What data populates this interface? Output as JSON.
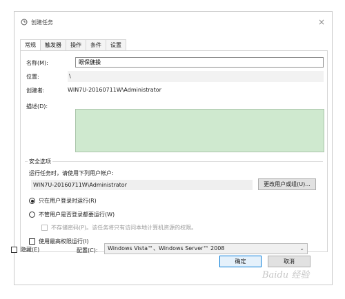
{
  "window": {
    "title": "创建任务",
    "close": "×"
  },
  "tabs": [
    {
      "label": "常规",
      "active": true
    },
    {
      "label": "触发器",
      "active": false
    },
    {
      "label": "操作",
      "active": false
    },
    {
      "label": "条件",
      "active": false
    },
    {
      "label": "设置",
      "active": false
    }
  ],
  "general": {
    "name_label": "名称(M):",
    "name_value": "眼保健操",
    "location_label": "位置:",
    "location_value": "\\",
    "author_label": "创建者:",
    "author_value": "WIN7U-20160711W\\Administrator",
    "description_label": "描述(D):"
  },
  "security": {
    "legend": "安全选项",
    "run_as_label": "运行任务时，请使用下列用户帐户:",
    "user_value": "WIN7U-20160711W\\Administrator",
    "change_button": "更改用户或组(U)...",
    "radio_logged_on": "只在用户登录时运行(R)",
    "radio_whether_logged": "不管用户是否登录都要运行(W)",
    "no_store_password": "不存储密码(P)。该任务将只有访问本地计算机资源的权限。",
    "highest_privileges": "使用最高权限运行(I)",
    "radio_selected": "logged_on"
  },
  "footer": {
    "hidden_label": "隐藏(E)",
    "configure_label": "配置(C):",
    "configure_value": "Windows Vista™、Windows Server™ 2008",
    "ok_button": "确定",
    "cancel_button": "取消"
  },
  "watermark": "Baidu 经验",
  "colors": {
    "description_bg": "#cfe9cf",
    "ok_border": "#0078d7",
    "window_border": "#c9c9c9"
  }
}
